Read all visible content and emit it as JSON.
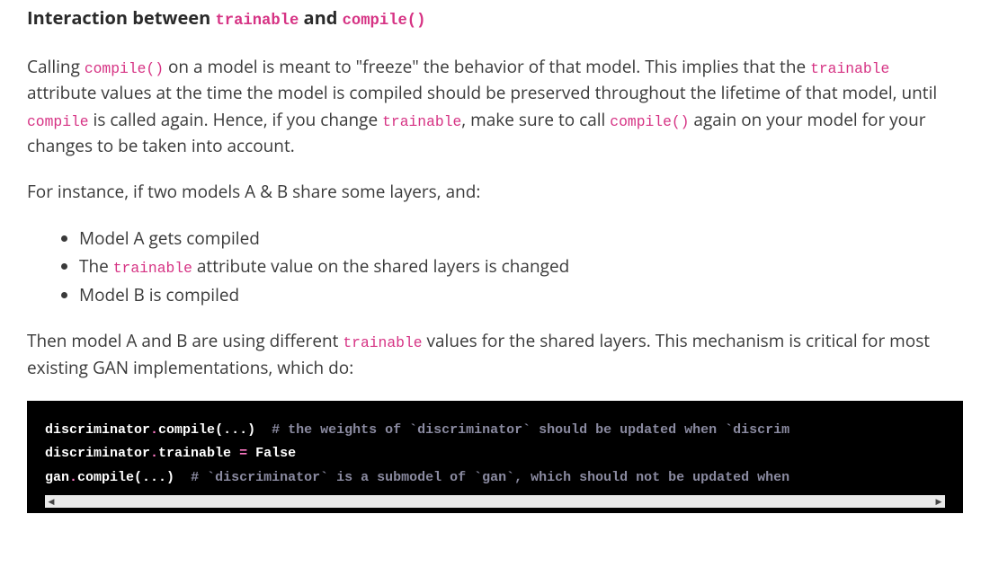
{
  "heading": {
    "pre": "Interaction between ",
    "code1": "trainable",
    "mid": " and ",
    "code2": "compile()"
  },
  "p1": {
    "seg1": "Calling ",
    "c1": "compile()",
    "seg2": " on a model is meant to \"freeze\" the behavior of that model. This implies that the ",
    "c2": "trainable",
    "seg3": " attribute values at the time the model is compiled should be preserved throughout the lifetime of that model, until ",
    "c3": "compile",
    "seg4": " is called again. Hence, if you change ",
    "c4": "trainable",
    "seg5": ", make sure to call ",
    "c5": "compile()",
    "seg6": " again on your model for your changes to be taken into account."
  },
  "p2": "For instance, if two models A & B share some layers, and:",
  "list": {
    "i1": "Model A gets compiled",
    "i2a": "The ",
    "i2code": "trainable",
    "i2b": " attribute value on the shared layers is changed",
    "i3": "Model B is compiled"
  },
  "p3": {
    "seg1": "Then model A and B are using different ",
    "c1": "trainable",
    "seg2": " values for the shared layers. This mechanism is critical for most existing GAN implementations, which do:"
  },
  "code": {
    "l1": {
      "id1": "discriminator",
      "dot1": ".",
      "fn": "compile",
      "paren": "(...)",
      "sp": "  ",
      "cmt": "# the weights of `discriminator` should be updated when `discrim"
    },
    "l2": {
      "id1": "discriminator",
      "dot1": ".",
      "attr": "trainable",
      "sp": " ",
      "eq": "=",
      "sp2": " ",
      "val": "False"
    },
    "l3": {
      "id1": "gan",
      "dot1": ".",
      "fn": "compile",
      "paren": "(...)",
      "sp": "  ",
      "cmt": "# `discriminator` is a submodel of `gan`, which should not be updated when"
    }
  },
  "scrollbar": {
    "left": "◀",
    "right": "▶"
  }
}
